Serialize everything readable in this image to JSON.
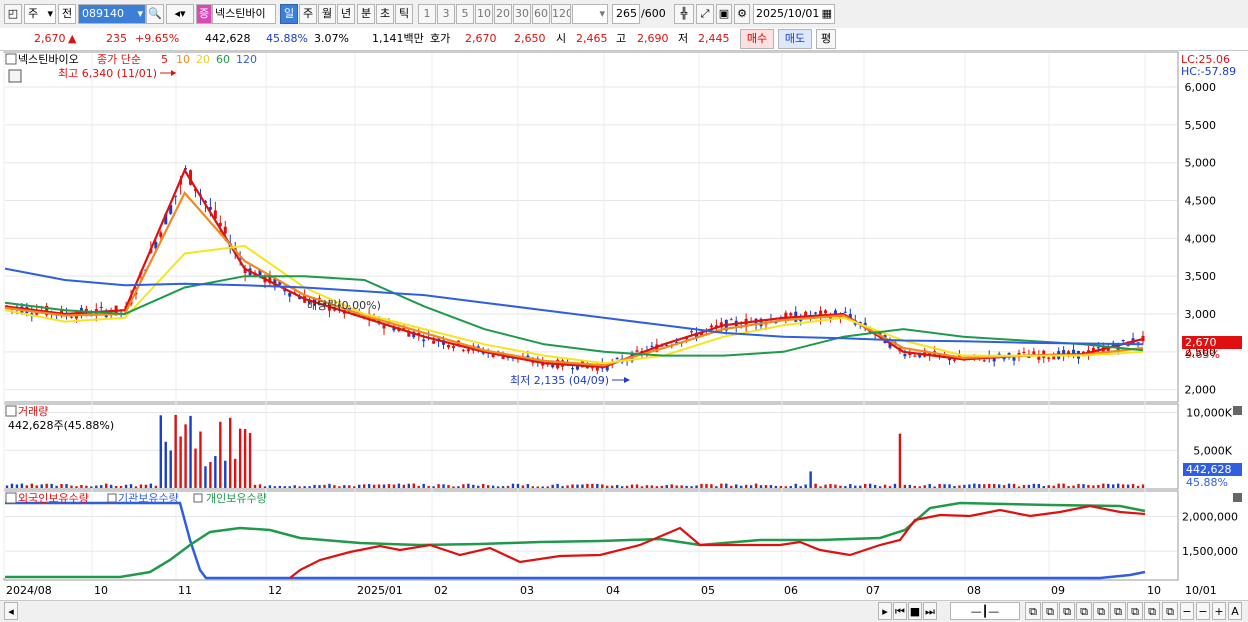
{
  "toolbar": {
    "market": "주",
    "scope": "전",
    "code": "089140",
    "stock_name": "넥스틴바이",
    "name_badge": "증",
    "periods": [
      "일",
      "주",
      "월",
      "년",
      "분",
      "초",
      "틱"
    ],
    "period_active": "일",
    "intervals": [
      "1",
      "3",
      "5",
      "10",
      "20",
      "30",
      "60",
      "120"
    ],
    "count_value": "265",
    "count_max": "/600",
    "date": "2025/10/01"
  },
  "quote": {
    "price": "2,670",
    "arrow": "▲",
    "change": "235",
    "change_pct": "+9.65%",
    "volume": "442,628",
    "volume_ratio": "45.88%",
    "turnover": "3.07%",
    "amount": "1,141백만",
    "hoga_label": "호가",
    "ask": "2,670",
    "bid": "2,650",
    "open_label": "시",
    "open": "2,465",
    "high_label": "고",
    "high": "2,690",
    "low_label": "저",
    "low": "2,445",
    "buy_label": "매수",
    "sell_label": "매도",
    "eval_label": "평"
  },
  "price_panel": {
    "title": "넥스틴바이오",
    "ma_label": "종가 단순",
    "ma_periods": [
      "5",
      "10",
      "20",
      "60",
      "120"
    ],
    "ma_colors": [
      "#e01010",
      "#f08a1e",
      "#f5e51e",
      "#1e9a4a",
      "#2f5fe0"
    ],
    "high_marker": "최고 6,340 (11/01)",
    "low_marker": "최저 2,135 (04/09)",
    "event_label": "배당락(0.00%)",
    "lc": "LC:25.06",
    "hc": "HC:-57.89",
    "price_tag": "2,670",
    "pct_tag": "9.65%"
  },
  "volume_panel": {
    "title": "거래량",
    "value": "442,628주(45.88%)",
    "tag_value": "442,628",
    "tag_pct": "45.88%"
  },
  "holdings_panel": {
    "labels": [
      "외국인보유수량",
      "기관보유수량",
      "개인보유수량"
    ],
    "colors": [
      "#e01010",
      "#2f5fe0",
      "#1e9a4a"
    ]
  },
  "x_axis": [
    "2024/08",
    "10",
    "11",
    "12",
    "2025/01",
    "02",
    "03",
    "04",
    "05",
    "06",
    "07",
    "08",
    "09",
    "10"
  ],
  "x_right": "10/01",
  "chart_data": [
    {
      "type": "line",
      "title": "넥스틴바이오",
      "y_ticks": [
        2000,
        2500,
        3000,
        3500,
        4000,
        4500,
        5000,
        5500,
        6000
      ],
      "ylim": [
        1850,
        6450
      ],
      "x": [
        "2024/08",
        "10",
        "11",
        "12",
        "2025/01",
        "02",
        "03",
        "04",
        "05",
        "06",
        "07",
        "08",
        "09",
        "10"
      ],
      "series": [
        {
          "name": "5",
          "values": [
            3100,
            3000,
            3050,
            4900,
            3600,
            3200,
            2950,
            2700,
            2500,
            2350,
            2300,
            2600,
            2850,
            2950,
            3000,
            2500,
            2400,
            2450,
            2470,
            2670
          ]
        },
        {
          "name": "10",
          "values": [
            3080,
            2980,
            3000,
            4600,
            3700,
            3250,
            2980,
            2750,
            2520,
            2380,
            2320,
            2550,
            2800,
            2920,
            2980,
            2550,
            2420,
            2450,
            2460,
            2550
          ]
        },
        {
          "name": "20",
          "values": [
            3050,
            2900,
            2950,
            3800,
            3900,
            3350,
            3000,
            2800,
            2600,
            2450,
            2350,
            2450,
            2700,
            2850,
            2950,
            2650,
            2450,
            2450,
            2450,
            2500
          ]
        },
        {
          "name": "60",
          "values": [
            3150,
            3050,
            3000,
            3350,
            3500,
            3500,
            3450,
            3100,
            2800,
            2600,
            2500,
            2450,
            2450,
            2500,
            2700,
            2800,
            2700,
            2650,
            2600,
            2520
          ]
        },
        {
          "name": "120",
          "values": [
            3600,
            3450,
            3380,
            3400,
            3380,
            3350,
            3300,
            3250,
            3150,
            3050,
            2950,
            2850,
            2750,
            2700,
            2680,
            2650,
            2640,
            2620,
            2610,
            2600
          ]
        }
      ],
      "annotations": {
        "max": 6340,
        "max_date": "11/01",
        "min": 2135,
        "min_date": "04/09",
        "last": 2670
      }
    },
    {
      "type": "bar",
      "title": "거래량",
      "y_ticks": [
        "5,000K",
        "10,000K"
      ],
      "last": 442628
    },
    {
      "type": "line",
      "title": "외국인보유수량 / 기관보유수량 / 개인보유수량",
      "y_ticks": [
        1500000,
        2000000
      ]
    }
  ]
}
